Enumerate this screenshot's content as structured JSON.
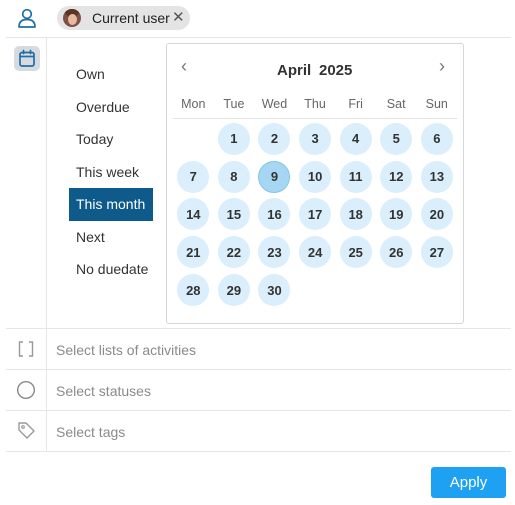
{
  "assignee": {
    "icon": "user-icon",
    "chip": {
      "label": "Current user",
      "remove_glyph": "✕",
      "avatar": "avatar"
    }
  },
  "due_date": {
    "icon": "calendar-icon",
    "options": [
      {
        "label": "Own",
        "selected": false
      },
      {
        "label": "Overdue",
        "selected": false
      },
      {
        "label": "Today",
        "selected": false
      },
      {
        "label": "This week",
        "selected": false
      },
      {
        "label": "This month",
        "selected": true
      },
      {
        "label": "Next",
        "selected": false
      },
      {
        "label": "No duedate",
        "selected": false
      }
    ],
    "calendar": {
      "month": "April",
      "year": "2025",
      "prev_glyph": "‹",
      "next_glyph": "›",
      "weekdays": [
        "Mon",
        "Tue",
        "Wed",
        "Thu",
        "Fri",
        "Sat",
        "Sun"
      ],
      "leading_blanks": 1,
      "days": [
        1,
        2,
        3,
        4,
        5,
        6,
        7,
        8,
        9,
        10,
        11,
        12,
        13,
        14,
        15,
        16,
        17,
        18,
        19,
        20,
        21,
        22,
        23,
        24,
        25,
        26,
        27,
        28,
        29,
        30
      ],
      "today": 9
    }
  },
  "lists": {
    "icon": "brackets-icon",
    "placeholder": "Select lists of activities"
  },
  "statuses": {
    "icon": "circle-icon",
    "placeholder": "Select statuses"
  },
  "tags": {
    "icon": "tag-icon",
    "placeholder": "Select tags"
  },
  "apply_label": "Apply",
  "colors": {
    "accent": "#1ea1f2",
    "selected_option": "#0e5a8a",
    "day_bg": "#daeefb",
    "today_bg": "#a5d7f3"
  }
}
